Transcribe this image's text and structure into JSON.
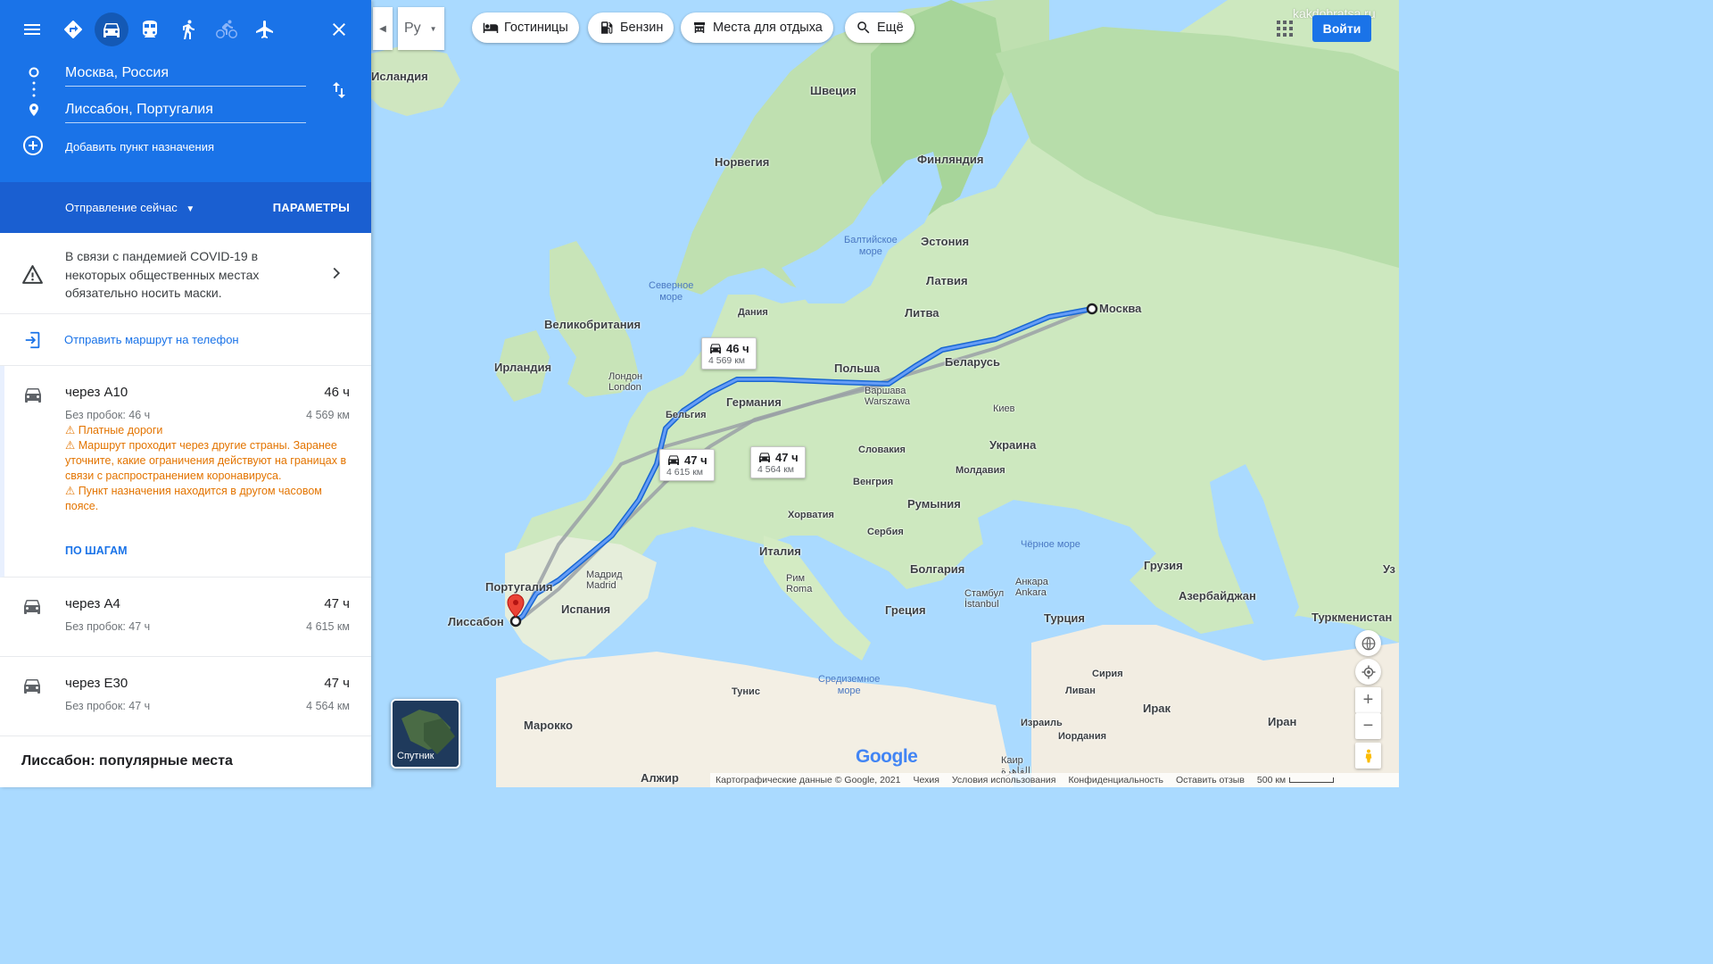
{
  "panel": {
    "modes": [
      "menu-icon",
      "best-icon",
      "car-icon",
      "transit-icon",
      "walk-icon",
      "bike-icon",
      "flight-icon",
      "close-icon"
    ],
    "origin": "Москва, Россия",
    "destination": "Лиссабон, Португалия",
    "add_destination": "Добавить пункт назначения",
    "departure": "Отправление сейчас",
    "params": "ПАРАМЕТРЫ",
    "covid_text": "В связи с пандемией COVID-19 в некоторых общественных местах обязательно носить маски.",
    "send_to_phone": "Отправить маршрут на телефон",
    "routes": [
      {
        "via": "через A10",
        "duration": "46 ч",
        "traffic": "Без пробок: 46 ч",
        "distance": "4 569 км",
        "warnings": [
          "Платные дороги",
          "Маршрут проходит через другие страны.",
          "Заранее уточните, какие ограничения действуют на границах в связи с распространением коронавируса.",
          "Пункт назначения находится в другом часовом поясе."
        ],
        "steps_link": "ПО ШАГАМ"
      },
      {
        "via": "через A4",
        "duration": "47 ч",
        "traffic": "Без пробок: 47 ч",
        "distance": "4 615 км"
      },
      {
        "via": "через E30",
        "duration": "47 ч",
        "traffic": "Без пробок: 47 ч",
        "distance": "4 564 км"
      }
    ],
    "popular_title": "Лиссабон: популярные места"
  },
  "map": {
    "language_select": "Ру",
    "chips": [
      "Гостиницы",
      "Бензин",
      "Места для отдыха",
      "Ещё"
    ],
    "watermark": "kakdobratsa.ru",
    "signin": "Войти",
    "bubbles": [
      {
        "duration": "46 ч",
        "distance": "4 569 км"
      },
      {
        "duration": "47 ч",
        "distance": "4 615 км"
      },
      {
        "duration": "47 ч",
        "distance": "4 564 км"
      }
    ],
    "satellite_label": "Спутник",
    "labels": {
      "iceland": "Исландия",
      "sweden": "Швеция",
      "norway": "Норвегия",
      "finland": "Финляндия",
      "estonia": "Эстония",
      "latvia": "Латвия",
      "lithuania": "Литва",
      "baltic_sea_1": "Балтийское",
      "baltic_sea_2": "море",
      "north_sea_1": "Северное",
      "north_sea_2": "море",
      "denmark": "Дания",
      "uk": "Великобритания",
      "ireland": "Ирландия",
      "london_ru": "Лондон",
      "london_en": "London",
      "belgium": "Бельгия",
      "germany": "Германия",
      "poland": "Польша",
      "warsaw_ru": "Варшава",
      "warsaw_en": "Warszawa",
      "belarus": "Беларусь",
      "moscow": "Москва",
      "kyiv": "Киев",
      "ukraine": "Украина",
      "slovakia": "Словакия",
      "hungary": "Венгрия",
      "moldova": "Молдавия",
      "romania": "Румыния",
      "croatia": "Хорватия",
      "serbia": "Сербия",
      "italy": "Италия",
      "rome_ru": "Рим",
      "rome_en": "Roma",
      "bulgaria": "Болгария",
      "greece": "Греция",
      "black_sea": "Чёрное море",
      "georgia": "Грузия",
      "azerbaijan": "Азербайджан",
      "ankara_ru": "Анкара",
      "ankara_en": "Ankara",
      "istanbul_ru": "Стамбул",
      "istanbul_en": "İstanbul",
      "turkey": "Турция",
      "turkmenistan": "Туркменистан",
      "uz": "Уз",
      "portugal": "Португалия",
      "madrid_ru": "Мадрид",
      "madrid_en": "Madrid",
      "spain": "Испания",
      "lisbon": "Лиссабон",
      "med_sea_1": "Средиземное",
      "med_sea_2": "море",
      "tunisia": "Тунис",
      "syria": "Сирия",
      "lebanon": "Ливан",
      "iraq": "Ирак",
      "iran": "Иран",
      "israel": "Израиль",
      "jordan": "Иордания",
      "cairo_ru": "Каир",
      "cairo_ar": "القاهرة",
      "morocco": "Марокко",
      "algeria": "Алжир"
    },
    "footer": [
      "Картографические данные © Google, 2021",
      "Чехия",
      "Условия использования",
      "Конфиденциальность",
      "Оставить отзыв",
      "500 км"
    ],
    "google_logo": "Google"
  }
}
